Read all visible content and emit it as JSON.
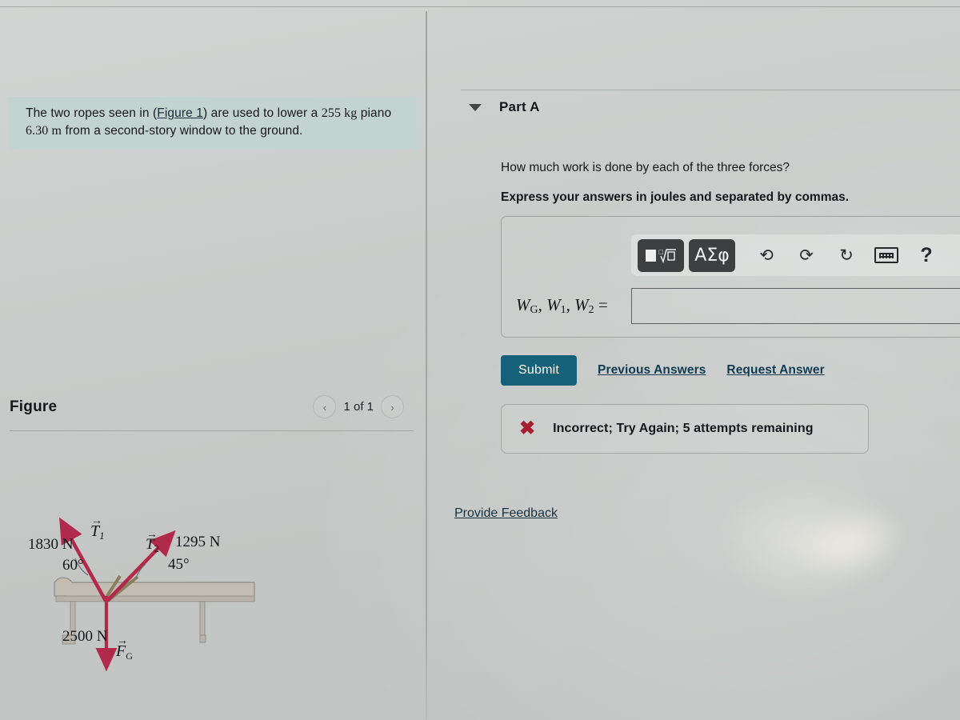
{
  "problem": {
    "text_before_link": "The two ropes seen in (",
    "figure_link": "Figure 1",
    "text_after_link": ") are used to lower a ",
    "mass": "255 kg",
    "mid_text": " piano ",
    "distance": "6.30 m",
    "text_end": " from a second-story window to the ground.",
    "full_text": "The two ropes seen in (Figure 1) are used to lower a 255 kg piano 6.30 m from a second-story window to the ground."
  },
  "figure_panel": {
    "title": "Figure",
    "prev_icon": "chevron-left-icon",
    "next_icon": "chevron-right-icon",
    "counter": "1 of 1"
  },
  "part": {
    "collapse_icon": "triangle-down-icon",
    "label": "Part A",
    "question": "How much work is done by each of the three forces?",
    "instruction": "Express your answers in joules and separated by commas."
  },
  "toolbar": {
    "template_button": "math-template-button",
    "greek_button": "ΑΣφ",
    "undo_icon": "undo-arrow-icon",
    "redo_icon": "redo-arrow-icon",
    "reset_icon": "refresh-circular-icon",
    "keyboard_icon": "keyboard-icon",
    "help_icon": "?"
  },
  "answer": {
    "label_main": "W",
    "label_sub_g": "G",
    "label_comma1": ", W",
    "label_sub_1": "1",
    "label_comma2": ", W",
    "label_sub_2": "2",
    "label_equals": " =",
    "label_full": "WG, W1, W2 =",
    "value": "",
    "placeholder": ""
  },
  "actions": {
    "submit_label": "Submit",
    "previous_answers_label": "Previous Answers",
    "request_answer_label": "Request Answer",
    "submit_color": "#156179",
    "link_color": "#0f3b52"
  },
  "feedback": {
    "icon": "x-mark-icon",
    "icon_color": "#a81f31",
    "message": "Incorrect; Try Again; 5 attempts remaining"
  },
  "provide_feedback": {
    "label": "Provide Feedback"
  },
  "figure_diagram": {
    "description": "Free-body diagram of a piano with two rope tensions and gravity",
    "vector_color": "#b12a4b",
    "piano_color": "#c2bcb2",
    "forces": [
      {
        "name": "T1",
        "label": "T⃗1",
        "magnitude": "1830 N",
        "angle": "60°",
        "direction": "up-left"
      },
      {
        "name": "T2",
        "label": "T⃗2",
        "magnitude": "1295 N",
        "angle": "45°",
        "direction": "up-right"
      },
      {
        "name": "FG",
        "label": "F⃗G",
        "magnitude": "2500 N",
        "angle": "",
        "direction": "down"
      }
    ],
    "labels": {
      "t1_mag": "1830 N",
      "t1_angle": "60°",
      "t1_name": "T",
      "t1_sub": "1",
      "t2_mag": "1295 N",
      "t2_angle": "45°",
      "t2_name": "T",
      "t2_sub": "2",
      "fg_mag": "2500 N",
      "fg_name": "F",
      "fg_sub": "G"
    }
  },
  "colors": {
    "highlight_bg": "#c3d4d0",
    "page_bg": "#cbcecc",
    "divider": "#787e7e"
  }
}
